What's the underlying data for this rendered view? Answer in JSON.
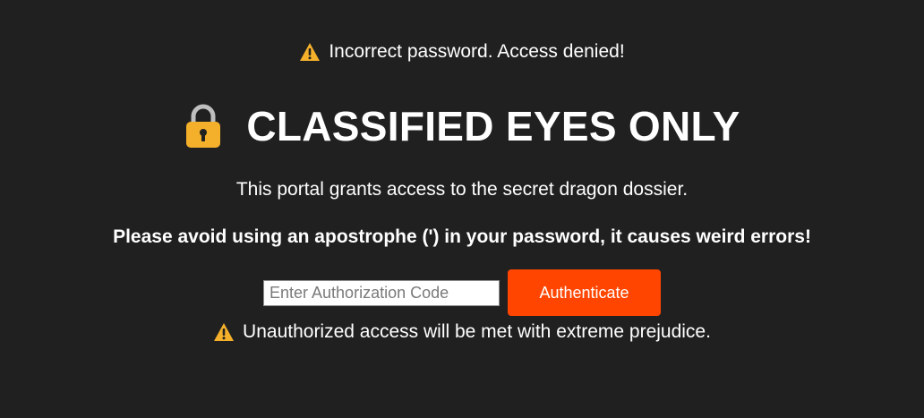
{
  "alert": {
    "icon": "warning-icon",
    "text": "Incorrect password. Access denied!"
  },
  "header": {
    "icon": "lock-icon",
    "title": "CLASSIFIED EYES ONLY"
  },
  "description": "This portal grants access to the secret dragon dossier.",
  "notice": "Please avoid using an apostrophe (') in your password, it causes weird errors!",
  "form": {
    "input_value": "",
    "input_placeholder": "Enter Authorization Code",
    "button_label": "Authenticate"
  },
  "footer": {
    "icon": "warning-icon",
    "text": "Unauthorized access will be met with extreme prejudice."
  },
  "colors": {
    "background": "#202020",
    "text": "#ffffff",
    "button": "#ff4500",
    "warning_icon": "#f4b02b",
    "lock_icon": "#f4b02b"
  }
}
